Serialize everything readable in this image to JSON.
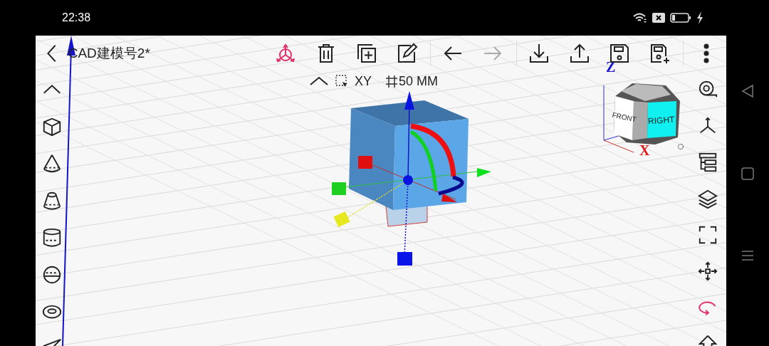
{
  "status_bar": {
    "time": "22:38"
  },
  "toolbar": {
    "title": "CAD建模号2*",
    "groups": [
      [
        {
          "kind": "gizmo",
          "active": true,
          "disabled": false
        },
        {
          "kind": "delete",
          "active": false,
          "disabled": false
        },
        {
          "kind": "duplicate",
          "active": false,
          "disabled": false
        },
        {
          "kind": "edit",
          "active": false,
          "disabled": false
        }
      ],
      [
        {
          "kind": "undo",
          "active": false,
          "disabled": false
        },
        {
          "kind": "redo",
          "active": false,
          "disabled": true
        }
      ],
      [
        {
          "kind": "download",
          "active": false,
          "disabled": false
        },
        {
          "kind": "upload",
          "active": false,
          "disabled": false
        },
        {
          "kind": "save",
          "active": false,
          "disabled": false
        },
        {
          "kind": "save_as",
          "active": false,
          "disabled": false
        }
      ],
      [
        {
          "kind": "more",
          "active": false,
          "disabled": false
        }
      ]
    ]
  },
  "view_bar": {
    "plane": "XY",
    "grid": "50 MM"
  },
  "left_tools": [
    {
      "kind": "collapse"
    },
    {
      "kind": "box"
    },
    {
      "kind": "cone"
    },
    {
      "kind": "frustum"
    },
    {
      "kind": "cylinder"
    },
    {
      "kind": "sphere"
    },
    {
      "kind": "torus"
    },
    {
      "kind": "plane"
    }
  ],
  "right_tools": [
    {
      "kind": "measure",
      "active": false
    },
    {
      "kind": "axes",
      "active": false
    },
    {
      "kind": "tree",
      "active": false
    },
    {
      "kind": "layers",
      "active": false
    },
    {
      "kind": "fit",
      "active": false
    },
    {
      "kind": "move",
      "active": false
    },
    {
      "kind": "rotate",
      "active": true
    },
    {
      "kind": "extrude",
      "active": false
    }
  ],
  "viewport": {
    "axis_labels": {
      "z": "Z",
      "x": "X"
    },
    "view_cube": {
      "front": "FRONT",
      "right": "RIGHT"
    }
  }
}
